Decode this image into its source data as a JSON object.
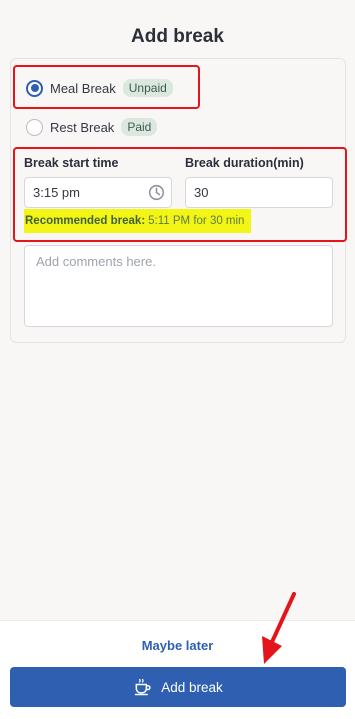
{
  "header": {
    "title": "Add break"
  },
  "break_types": [
    {
      "label": "Meal Break",
      "badge": "Unpaid",
      "selected": true
    },
    {
      "label": "Rest Break",
      "badge": "Paid",
      "selected": false
    }
  ],
  "form": {
    "start_label": "Break start time",
    "start_value": "3:15 pm",
    "duration_label": "Break duration(min)",
    "duration_value": "30",
    "recommended_key": "Recommended break:",
    "recommended_value": "5:11 PM for 30 min",
    "comments_placeholder": "Add comments here."
  },
  "footer": {
    "secondary_label": "Maybe later",
    "primary_label": "Add break"
  },
  "colors": {
    "accent": "#2e5fb0",
    "annotation_red": "#e3141a",
    "highlight_yellow": "#f3f515",
    "badge_bg": "#dbe8e0"
  },
  "icons": [
    "clock-icon",
    "coffee-cup-icon"
  ]
}
